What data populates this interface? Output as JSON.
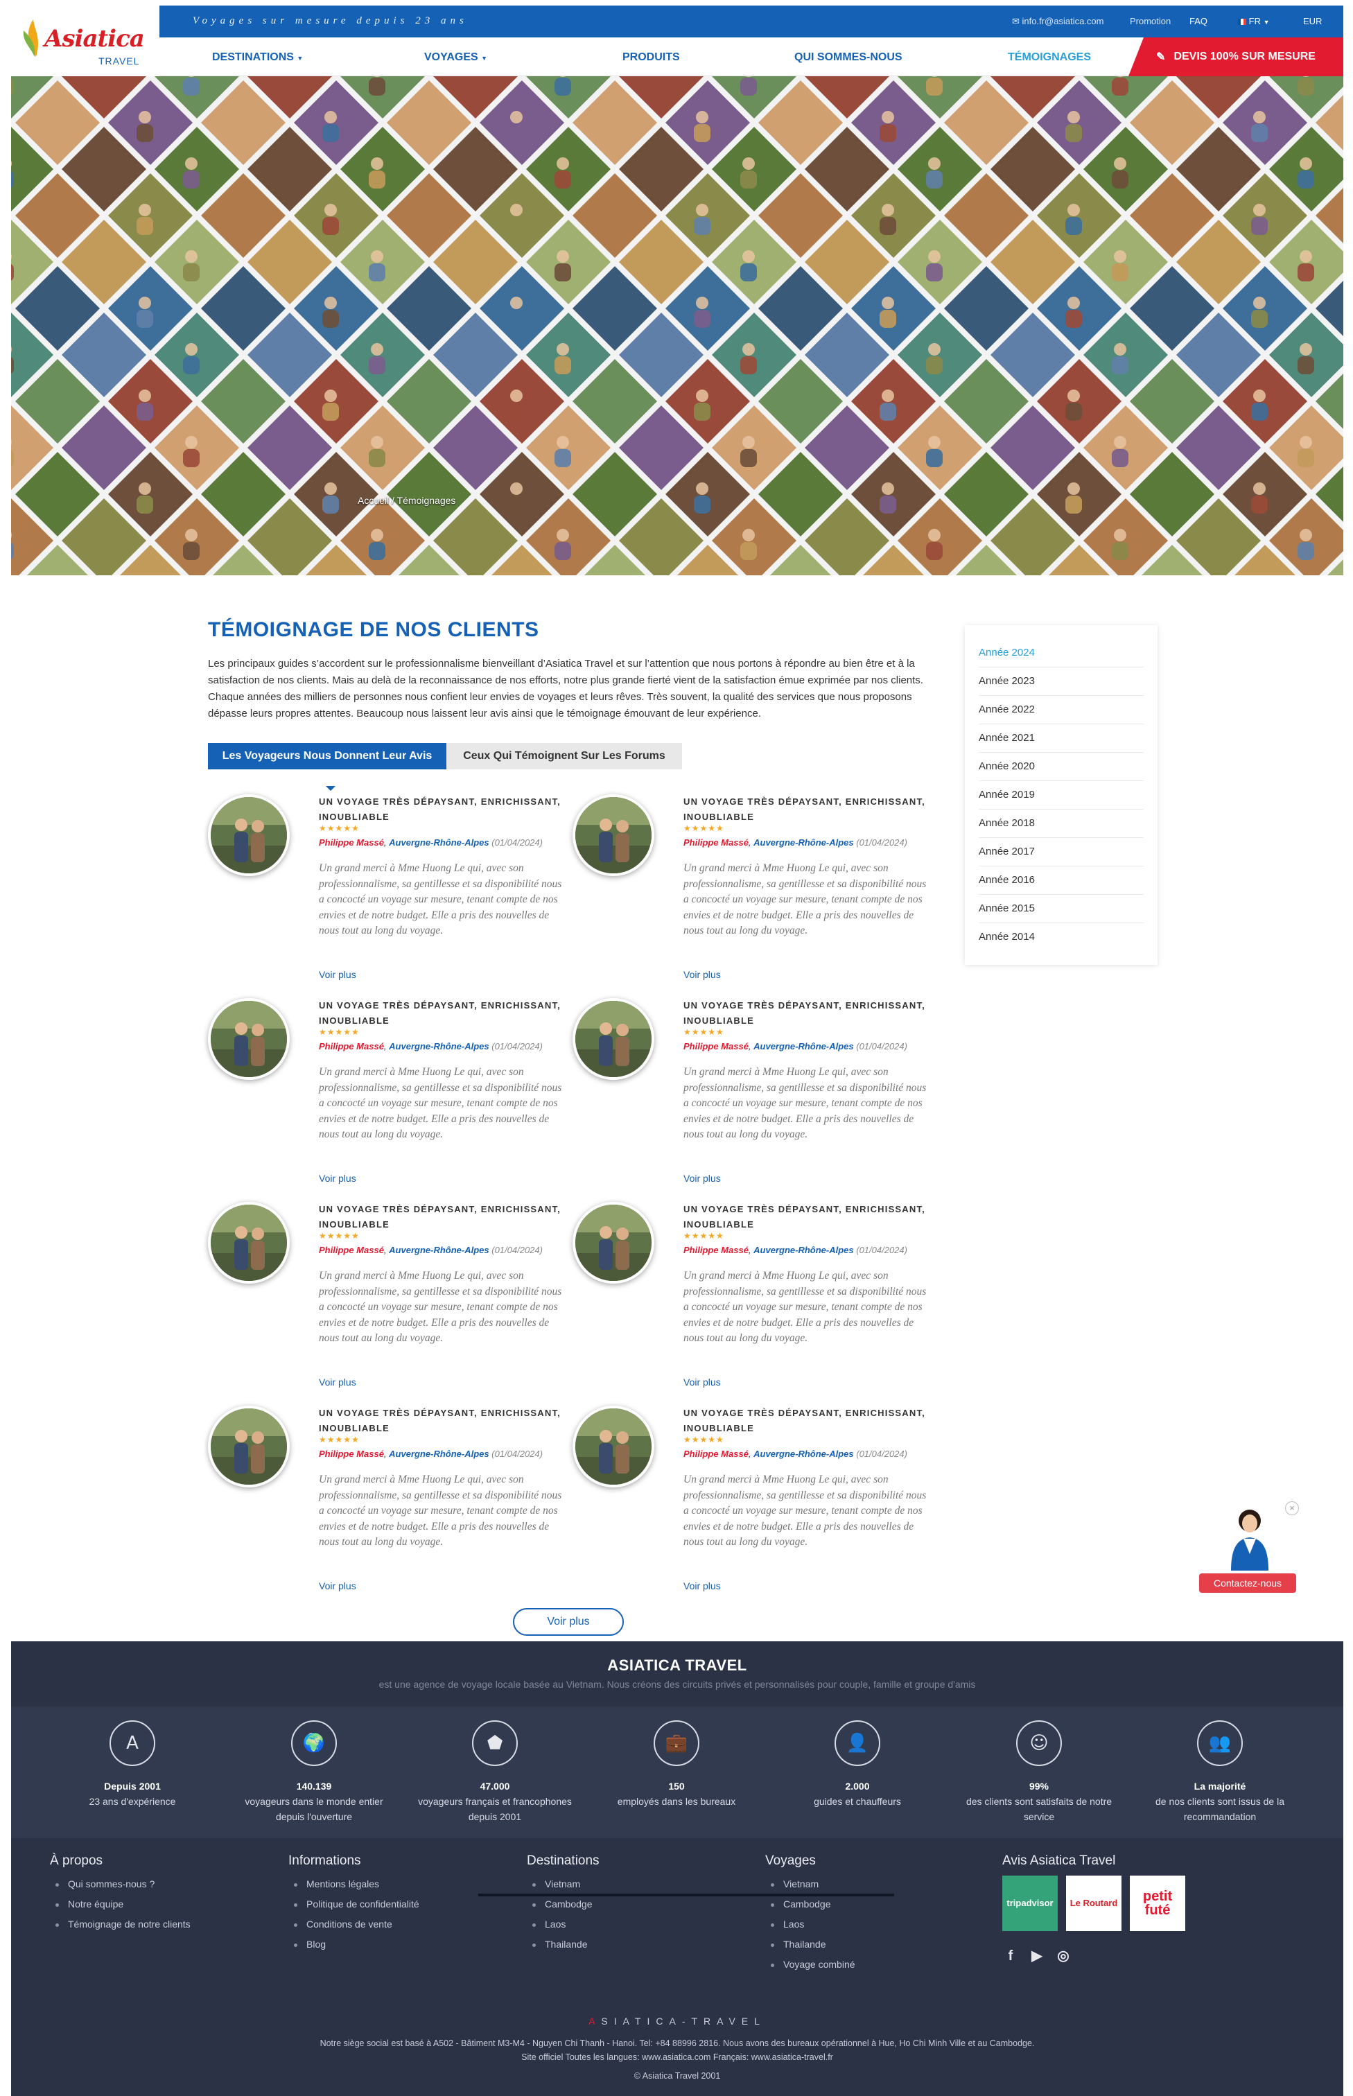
{
  "header": {
    "logo_brand": "Asiatica",
    "logo_sub": "TRAVEL",
    "tagline": "Voyages sur mesure depuis 23 ans",
    "email": "info.fr@asiatica.com",
    "promo_label": "Promotion",
    "faq_label": "FAQ",
    "lang_label": "FR",
    "currency_label": "EUR",
    "nav": [
      "DESTINATIONS",
      "VOYAGES",
      "PRODUITS",
      "QUI SOMMES-NOUS",
      "TÉMOIGNAGES"
    ],
    "cta_label": "DEVIS 100% SUR MESURE",
    "colors": {
      "primary": "#1561b5",
      "accent": "#e21b31",
      "active": "#25a0d8"
    }
  },
  "hero": {
    "breadcrumb_home": "Accueil",
    "breadcrumb_sep": "/",
    "breadcrumb_current": "Témoignages"
  },
  "main": {
    "title": "TÉMOIGNAGE DE NOS CLIENTS",
    "intro": "Les principaux guides s’accordent sur le professionnalisme bienveillant d’Asiatica Travel et sur l’attention que nous portons à répondre au bien être et à la satisfaction de nos clients. Mais au delà de la reconnaissance de nos efforts, notre plus grande fierté vient de la satisfaction émue exprimée par nos clients. Chaque années des milliers de personnes nous confient leur envies de voyages et leurs rêves. Très souvent, la qualité des services que nous proposons dépasse leurs propres attentes. Beaucoup nous laissent leur avis ainsi que le témoignage émouvant de leur expérience.",
    "tabs": [
      "Les Voyageurs Nous Donnent Leur Avis",
      "Ceux Qui Témoignent Sur Les Forums"
    ],
    "load_more": "Voir plus"
  },
  "reviews": [
    {
      "title": "UN VOYAGE TRÈS DÉPAYSANT, ENRICHISSANT, INOUBLIABLE",
      "stars": "★★★★★",
      "author": "Philippe Massé",
      "region": "Auvergne-Rhône-Alpes",
      "date": "(01/04/2024)",
      "text": "Un grand merci à Mme Huong Le qui, avec son professionnalisme, sa gentillesse et sa disponibilité nous a concocté un voyage sur mesure, tenant compte de nos envies et de notre budget. Elle a pris des nouvelles de nous tout au long du voyage.",
      "more": "Voir plus"
    },
    {
      "title": "UN VOYAGE TRÈS DÉPAYSANT, ENRICHISSANT, INOUBLIABLE",
      "stars": "★★★★★",
      "author": "Philippe Massé",
      "region": "Auvergne-Rhône-Alpes",
      "date": "(01/04/2024)",
      "text": "Un grand merci à Mme Huong Le qui, avec son professionnalisme, sa gentillesse et sa disponibilité nous a concocté un voyage sur mesure, tenant compte de nos envies et de notre budget. Elle a pris des nouvelles de nous tout au long du voyage.",
      "more": "Voir plus"
    },
    {
      "title": "UN VOYAGE TRÈS DÉPAYSANT, ENRICHISSANT, INOUBLIABLE",
      "stars": "★★★★★",
      "author": "Philippe Massé",
      "region": "Auvergne-Rhône-Alpes",
      "date": "(01/04/2024)",
      "text": "Un grand merci à Mme Huong Le qui, avec son professionnalisme, sa gentillesse et sa disponibilité nous a concocté un voyage sur mesure, tenant compte de nos envies et de notre budget. Elle a pris des nouvelles de nous tout au long du voyage.",
      "more": "Voir plus"
    },
    {
      "title": "UN VOYAGE TRÈS DÉPAYSANT, ENRICHISSANT, INOUBLIABLE",
      "stars": "★★★★★",
      "author": "Philippe Massé",
      "region": "Auvergne-Rhône-Alpes",
      "date": "(01/04/2024)",
      "text": "Un grand merci à Mme Huong Le qui, avec son professionnalisme, sa gentillesse et sa disponibilité nous a concocté un voyage sur mesure, tenant compte de nos envies et de notre budget. Elle a pris des nouvelles de nous tout au long du voyage.",
      "more": "Voir plus"
    },
    {
      "title": "UN VOYAGE TRÈS DÉPAYSANT, ENRICHISSANT, INOUBLIABLE",
      "stars": "★★★★★",
      "author": "Philippe Massé",
      "region": "Auvergne-Rhône-Alpes",
      "date": "(01/04/2024)",
      "text": "Un grand merci à Mme Huong Le qui, avec son professionnalisme, sa gentillesse et sa disponibilité nous a concocté un voyage sur mesure, tenant compte de nos envies et de notre budget. Elle a pris des nouvelles de nous tout au long du voyage.",
      "more": "Voir plus"
    },
    {
      "title": "UN VOYAGE TRÈS DÉPAYSANT, ENRICHISSANT, INOUBLIABLE",
      "stars": "★★★★★",
      "author": "Philippe Massé",
      "region": "Auvergne-Rhône-Alpes",
      "date": "(01/04/2024)",
      "text": "Un grand merci à Mme Huong Le qui, avec son professionnalisme, sa gentillesse et sa disponibilité nous a concocté un voyage sur mesure, tenant compte de nos envies et de notre budget. Elle a pris des nouvelles de nous tout au long du voyage.",
      "more": "Voir plus"
    },
    {
      "title": "UN VOYAGE TRÈS DÉPAYSANT, ENRICHISSANT, INOUBLIABLE",
      "stars": "★★★★★",
      "author": "Philippe Massé",
      "region": "Auvergne-Rhône-Alpes",
      "date": "(01/04/2024)",
      "text": "Un grand merci à Mme Huong Le qui, avec son professionnalisme, sa gentillesse et sa disponibilité nous a concocté un voyage sur mesure, tenant compte de nos envies et de notre budget. Elle a pris des nouvelles de nous tout au long du voyage.",
      "more": "Voir plus"
    },
    {
      "title": "UN VOYAGE TRÈS DÉPAYSANT, ENRICHISSANT, INOUBLIABLE",
      "stars": "★★★★★",
      "author": "Philippe Massé",
      "region": "Auvergne-Rhône-Alpes",
      "date": "(01/04/2024)",
      "text": "Un grand merci à Mme Huong Le qui, avec son professionnalisme, sa gentillesse et sa disponibilité nous a concocté un voyage sur mesure, tenant compte de nos envies et de notre budget. Elle a pris des nouvelles de nous tout au long du voyage.",
      "more": "Voir plus"
    }
  ],
  "sidebar": {
    "years": [
      "Année 2024",
      "Année 2023",
      "Année 2022",
      "Année 2021",
      "Année 2020",
      "Année 2019",
      "Année 2018",
      "Année 2017",
      "Année 2016",
      "Année 2015",
      "Année 2014"
    ],
    "active_index": 0
  },
  "contact_widget": {
    "button_label": "Contactez-nous",
    "close_symbol": "×"
  },
  "footer": {
    "title": "ASIATICA TRAVEL",
    "subtitle": "est une agence de voyage locale basée au Vietnam. Nous créons des circuits privés et personnalisés pour couple, famille et groupe d'amis",
    "stats": [
      {
        "icon": "asiatica-logo-icon",
        "big": "Depuis 2001",
        "label": "23 ans d'expérience"
      },
      {
        "icon": "globe-icon",
        "big": "140.139",
        "label": "voyageurs dans le monde entier depuis l'ouverture"
      },
      {
        "icon": "france-map-icon",
        "big": "47.000",
        "label": "voyageurs français et francophones depuis 2001"
      },
      {
        "icon": "briefcase-icon",
        "big": "150",
        "label": "employés dans les bureaux"
      },
      {
        "icon": "driver-icon",
        "big": "2.000",
        "label": "guides et chauffeurs"
      },
      {
        "icon": "smiley-icon",
        "big": "99%",
        "label": "des clients sont satisfaits de notre service"
      },
      {
        "icon": "recommend-user-icon",
        "big": "La majorité",
        "label": "de nos clients sont issus de la recommandation"
      }
    ],
    "columns": [
      {
        "heading": "À propos",
        "items": [
          "Qui sommes-nous ?",
          "Notre équipe",
          "Témoignage de notre clients"
        ]
      },
      {
        "heading": "Informations",
        "items": [
          "Mentions légales",
          "Politique de confidentialité",
          "Conditions de vente",
          "Blog"
        ]
      },
      {
        "heading": "Destinations",
        "items": [
          "Vietnam",
          "Cambodge",
          "Laos",
          "Thailande"
        ]
      },
      {
        "heading": "Voyages",
        "items": [
          "Vietnam",
          "Cambodge",
          "Laos",
          "Thailande",
          "Voyage combiné"
        ]
      }
    ],
    "avis_heading": "Avis Asiatica Travel",
    "badges": [
      "tripadvisor",
      "Le Routard",
      "petit futé"
    ],
    "social_icons": [
      "facebook-icon",
      "youtube-icon",
      "instagram-icon"
    ],
    "brand_line_first": "A",
    "brand_line_rest": "SIATICA-TRAVEL",
    "address_line1": "Notre siège social est basé à A502 - Bâtiment M3-M4 - Nguyen Chi Thanh - Hanoi.  Tel: +84 88996 2816. Nous avons des bureaux opérationnel à Hue, Ho Chi Minh Ville et au Cambodge.",
    "address_line2": "Site officiel Toutes les langues: www.asiatica.com  Français: www.asiatica-travel.fr",
    "copyright": "© Asiatica Travel 2001"
  }
}
